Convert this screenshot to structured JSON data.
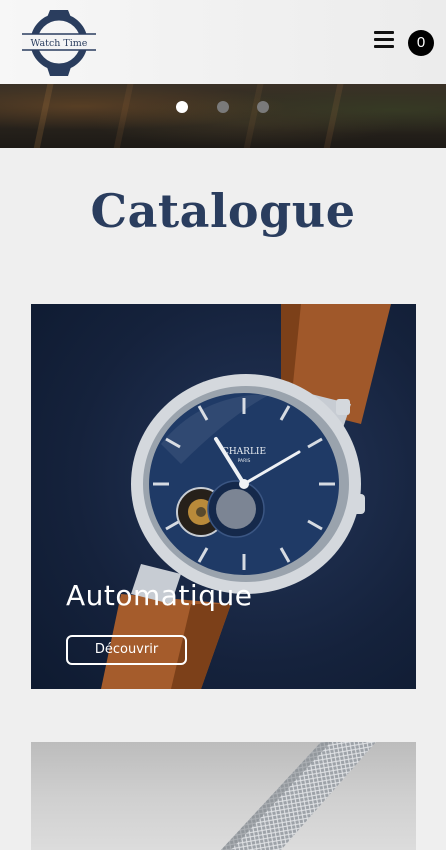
{
  "header": {
    "logo_text": "Watch Time",
    "menu_icon": "hamburger-menu-icon",
    "cart_count": "0"
  },
  "hero": {
    "slides": 3,
    "active_slide": 1
  },
  "catalogue": {
    "title": "Catalogue",
    "cards": [
      {
        "title": "Automatique",
        "button_label": "Découvrir"
      },
      {
        "title": "",
        "button_label": ""
      }
    ]
  },
  "colors": {
    "brand_navy": "#2a3d5e",
    "card_background": "#15223c",
    "strap_brown": "#a0582a"
  }
}
